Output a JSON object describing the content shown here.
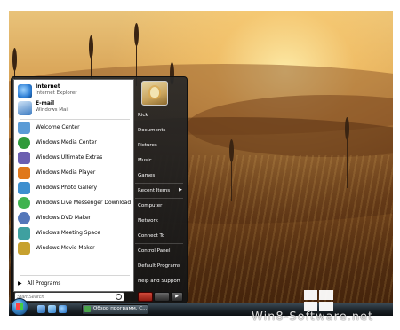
{
  "start_menu": {
    "pinned": [
      {
        "title": "Internet",
        "subtitle": "Internet Explorer",
        "icon": "internet-explorer-icon",
        "color": "#2e7fd6"
      },
      {
        "title": "E-mail",
        "subtitle": "Windows Mail",
        "icon": "windows-mail-icon",
        "color": "#3b7ac1"
      }
    ],
    "programs": [
      {
        "label": "Welcome Center",
        "icon": "welcome-center-icon",
        "color": "#5a9bd6"
      },
      {
        "label": "Windows Media Center",
        "icon": "media-center-icon",
        "color": "#2f9a3b"
      },
      {
        "label": "Windows Ultimate Extras",
        "icon": "ultimate-extras-icon",
        "color": "#6b5fb0"
      },
      {
        "label": "Windows Media Player",
        "icon": "media-player-icon",
        "color": "#e0781b"
      },
      {
        "label": "Windows Photo Gallery",
        "icon": "photo-gallery-icon",
        "color": "#3d8fcf"
      },
      {
        "label": "Windows Live Messenger Download",
        "icon": "messenger-icon",
        "color": "#3fb34f"
      },
      {
        "label": "Windows DVD Maker",
        "icon": "dvd-maker-icon",
        "color": "#5477b9"
      },
      {
        "label": "Windows Meeting Space",
        "icon": "meeting-space-icon",
        "color": "#3fa0a0"
      },
      {
        "label": "Windows Movie Maker",
        "icon": "movie-maker-icon",
        "color": "#c7a12f"
      }
    ],
    "all_programs": "All Programs",
    "search_placeholder": "Start Search",
    "right_items": [
      {
        "label": "Rick"
      },
      {
        "label": "Documents"
      },
      {
        "label": "Pictures"
      },
      {
        "label": "Music"
      },
      {
        "label": "Games"
      },
      {
        "label": "Recent Items",
        "submenu": true
      },
      {
        "label": "Computer"
      },
      {
        "label": "Network"
      },
      {
        "label": "Connect To"
      },
      {
        "label": "Control Panel"
      },
      {
        "label": "Default Programs"
      },
      {
        "label": "Help and Support"
      }
    ]
  },
  "taskbar": {
    "task_label": "Обзор программ, С..."
  },
  "watermark": {
    "text": "Win8-Software.net"
  }
}
